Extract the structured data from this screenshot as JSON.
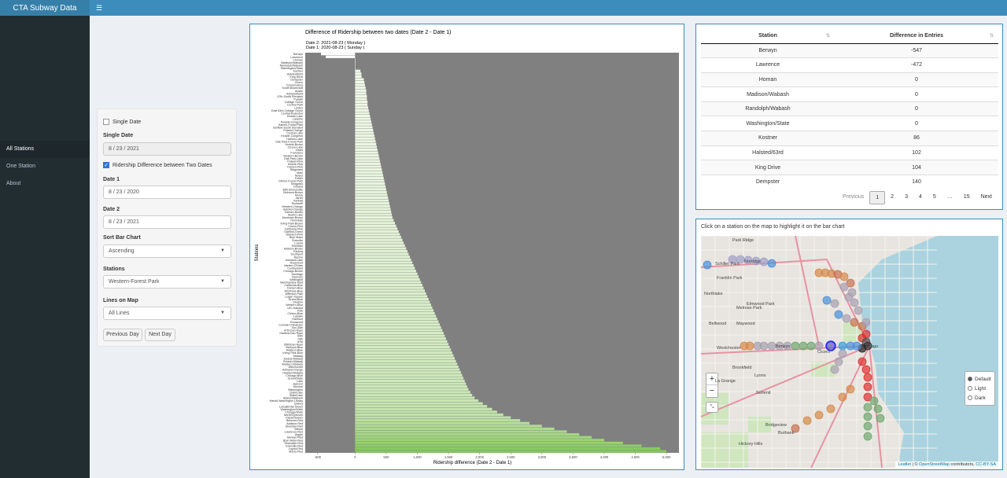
{
  "app": {
    "title": "CTA Subway Data",
    "menu_icon": "hamburger-icon"
  },
  "sidebar": {
    "items": [
      {
        "label": "All Stations",
        "active": true
      },
      {
        "label": "One Station",
        "active": false
      },
      {
        "label": "About",
        "active": false
      }
    ]
  },
  "controls": {
    "single_date_label": "Single Date",
    "single_date_checked": false,
    "single_date_title": "Single Date",
    "single_date_value": "8 / 23 / 2021",
    "diff_label": "Ridership Difference between Two Dates",
    "diff_checked": true,
    "date1_title": "Date 1",
    "date1_value": "8 / 23 / 2020",
    "date2_title": "Date 2",
    "date2_value": "8 / 23 / 2021",
    "sort_title": "Sort Bar Chart",
    "sort_value": "Ascending",
    "stations_title": "Stations",
    "stations_value": "Western-Forest Park",
    "lines_title": "Lines on Map",
    "lines_value": "All Lines",
    "prev_day": "Previous Day",
    "next_day": "Next Day"
  },
  "chart_data": {
    "type": "bar",
    "orientation": "horizontal",
    "title": "Difference of Ridership between two dates (Date 2 - Date 1)",
    "subtitle_line1": "Date 2:  2021-08-23  ( Monday )",
    "subtitle_line2": "Date 1:  2020-08-23  ( Sunday )",
    "xlabel": "Ridership difference (Date 2 - Date 1)",
    "ylabel": "Stations",
    "xlim": [
      -800,
      5200
    ],
    "xticks": [
      -600,
      0,
      500,
      1000,
      1500,
      2000,
      2500,
      3000,
      3500,
      4000,
      4500,
      5000
    ],
    "xtick_labels": [
      "-600",
      "0",
      "500",
      "1,000",
      "1,500",
      "2,000",
      "2,500",
      "3,000",
      "3,500",
      "4,000",
      "4,500",
      "5,000"
    ],
    "categories": [
      "Berwyn",
      "Lawrence",
      "Homan",
      "Madison/Wabash",
      "Randolph/Wabash",
      "Washington/State",
      "Kostner",
      "Halsted/63rd",
      "King Drive",
      "Dempster",
      "Cicero",
      "Conservatory",
      "South Boulevard",
      "Austin",
      "Ashland/63rd",
      "47th-South Elevated",
      "Pulaski",
      "Cottage Grove",
      "Central Park",
      "Linden",
      "East 63rd-Cottage Grove",
      "Central-Evanston",
      "Kedzie-Lake",
      "Laramie",
      "Pulaski-Congress",
      "Harlem-Forest Park",
      "Garfield-South Elevated",
      "Pulaski-Orange",
      "Central-Lake",
      "Kedzie-Congress",
      "Harlem-Lake",
      "Oak Park-Forest Park",
      "Kedzie-Brown",
      "Cicero-Lake",
      "Davis",
      "Francisco",
      "Western-Brown",
      "Oak Park-Lake",
      "Pulaski-Pink",
      "Kedzie-Pink",
      "Damen-Pink",
      "Ridgeland",
      "Main",
      "Noyes",
      "Foster",
      "Clinton-Forest Park",
      "Sedgwick",
      "Indiana",
      "35th-Bronzeville",
      "Belmont-Brown",
      "Morse",
      "Jarvis",
      "Kimball",
      "Rockwell",
      "Western-Orange",
      "Halsted-Orange",
      "Damen-Brown",
      "Austin-Lake",
      "Montrose-Brown",
      "Thorndale",
      "Irving Park-Brown",
      "Cicero-Pink",
      "California-Pink",
      "Garfield-Green",
      "Western-Pink",
      "Bryn Mawr",
      "Granville",
      "Loyola",
      "Sheridan",
      "Addison-Brown",
      "Paulina",
      "Southport",
      "Racine",
      "Ashland-Lake",
      "Rosemont",
      "Harlem-O'Hare",
      "Cumberland",
      "Chicago-Brown",
      "Armitage",
      "Diversey",
      "Wellington",
      "Merchandise Mart",
      "California-Blue",
      "Damen-Blue",
      "Montrose-Blue",
      "Jefferson Park",
      "Logan Square",
      "Grand-Blue",
      "Division",
      "Western-Blue",
      "UIC-Halsted",
      "Polk",
      "Clinton-Blue",
      "LaSalle",
      "Harrison",
      "Roosevelt",
      "Cermak-Chinatown",
      "Sox-35th",
      "47th-Dan Ryan",
      "Garfield-Dan Ryan",
      "69th",
      "79th",
      "87th",
      "95th/Dan Ryan",
      "Belmont-Blue",
      "Addison-Blue",
      "Irving Park-Blue",
      "Midway",
      "Kedzie-Midway",
      "Pulaski-Midway",
      "Western-Midway",
      "35th/Archer",
      "Ashland-Orange",
      "Halsted-Midway",
      "Chicago-Blue",
      "Grand/State",
      "Lake",
      "Jackson",
      "Monroe",
      "Washington",
      "Clark/Lake",
      "State/Lake",
      "Adams/Wabash",
      "Harold Washington Library",
      "Quincy",
      "LaSalle/Van Buren",
      "Washington/Wells",
      "Chicago/State",
      "North/Clybourn",
      "Clark/Division",
      "Belmont-Red",
      "Addison-Red",
      "Sheridan-Red",
      "Wilson",
      "Lawrence-Red",
      "Argyle",
      "Berwyn-Red",
      "Bryn Mawr-Red",
      "Thorndale-Red",
      "Granville-Red",
      "Loyola-Red",
      "Morse-Red",
      "Jarvis-Red",
      "Howard",
      "Fullerton",
      "O'Hare"
    ],
    "values": [
      -547,
      -472,
      0,
      0,
      0,
      0,
      86,
      102,
      104,
      140,
      150,
      160,
      170,
      180,
      180,
      190,
      190,
      200,
      200,
      210,
      220,
      230,
      240,
      250,
      260,
      270,
      280,
      290,
      300,
      310,
      320,
      330,
      340,
      350,
      360,
      370,
      380,
      390,
      400,
      410,
      420,
      430,
      440,
      450,
      460,
      470,
      480,
      490,
      500,
      510,
      520,
      530,
      540,
      550,
      560,
      570,
      580,
      590,
      600,
      620,
      640,
      660,
      680,
      700,
      720,
      740,
      760,
      780,
      800,
      820,
      840,
      860,
      880,
      900,
      920,
      940,
      960,
      980,
      1000,
      1020,
      1040,
      1060,
      1080,
      1100,
      1120,
      1140,
      1160,
      1180,
      1200,
      1220,
      1240,
      1260,
      1280,
      1300,
      1320,
      1340,
      1360,
      1380,
      1400,
      1420,
      1440,
      1460,
      1480,
      1500,
      1520,
      1540,
      1560,
      1580,
      1600,
      1620,
      1640,
      1660,
      1680,
      1700,
      1720,
      1740,
      1760,
      1780,
      1800,
      1820,
      1850,
      1880,
      1920,
      1980,
      2050,
      2120,
      2200,
      2280,
      2380,
      2500,
      2650,
      2800,
      3000,
      3200,
      3400,
      3600,
      3800,
      4000,
      4300,
      4600,
      4900,
      5000
    ]
  },
  "table": {
    "headers": [
      "Station",
      "Difference in Entries"
    ],
    "rows": [
      [
        "Berwyn",
        "-547"
      ],
      [
        "Lawrence",
        "-472"
      ],
      [
        "Homan",
        "0"
      ],
      [
        "Madison/Wabash",
        "0"
      ],
      [
        "Randolph/Wabash",
        "0"
      ],
      [
        "Washington/State",
        "0"
      ],
      [
        "Kostner",
        "86"
      ],
      [
        "Halsted/63rd",
        "102"
      ],
      [
        "King Drive",
        "104"
      ],
      [
        "Dempster",
        "140"
      ]
    ],
    "pager": {
      "previous": "Previous",
      "pages": [
        "1",
        "2",
        "3",
        "4",
        "5",
        "…",
        "15"
      ],
      "current": "1",
      "next": "Next"
    }
  },
  "map": {
    "instruction": "Click on a station on the map to highlight it on the bar chart",
    "zoom_in": "+",
    "zoom_out": "−",
    "layers": [
      {
        "label": "Default",
        "checked": true
      },
      {
        "label": "Light",
        "checked": false
      },
      {
        "label": "Dark",
        "checked": false
      }
    ],
    "attribution_leaflet": "Leaflet",
    "attribution_osm": "OpenStreetMap",
    "attribution_rest": "contributors,",
    "attribution_license": "CC-BY-SA",
    "labels": [
      "Park Ridge",
      "Norridge",
      "Schiller Park",
      "Franklin Park",
      "Northlake",
      "Elmwood Park",
      "Melrose Park",
      "Maywood",
      "Bellwood",
      "Chicago",
      "Berwyn",
      "Cicero",
      "Brookfield",
      "Lyons",
      "La Grange",
      "Summit",
      "Bridgeview",
      "Burbank",
      "Hickory Hills",
      "Westchester"
    ]
  },
  "colors": {
    "bar_neg": "#ffffff",
    "bar_low": "#f3f9ec",
    "bar_high": "#86c95a",
    "panel_bg": "#808080",
    "primary": "#3c8dbc"
  }
}
